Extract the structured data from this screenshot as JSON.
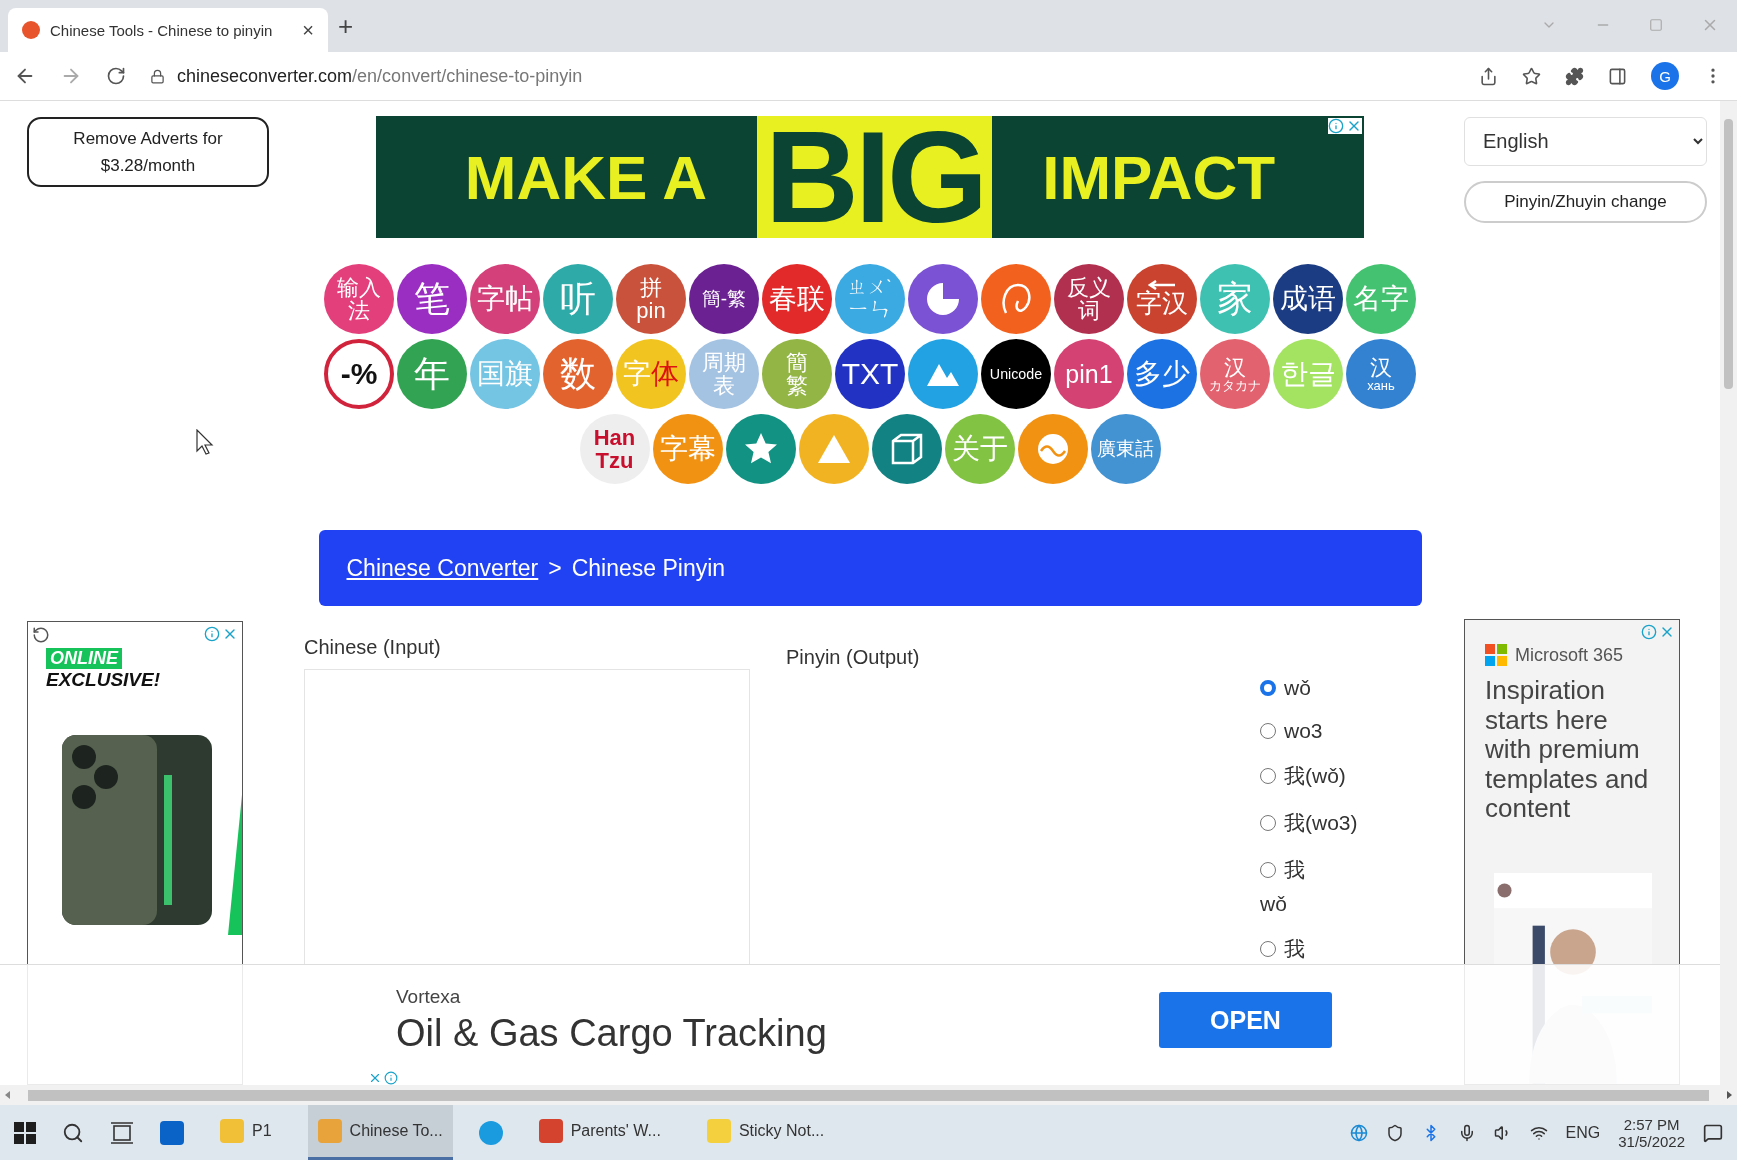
{
  "browser": {
    "tab_title": "Chinese Tools - Chinese to pinyin",
    "tab_close": "×",
    "new_tab": "+",
    "profile": "G",
    "url_domain": "chineseconverter.com",
    "url_path": "/en/convert/chinese-to-pinyin"
  },
  "remove_adverts": {
    "lines": [
      "Remove Adverts for",
      "$3.28/month"
    ]
  },
  "banner_ad": {
    "left": "MAKE A",
    "big": "BIG",
    "right": "IMPACT"
  },
  "language_select": {
    "value": "English"
  },
  "pinyin_zhuyin_button": "Pinyin/Zhuyin change",
  "tools": [
    [
      {
        "kind": "text",
        "color": "#e33f7a",
        "lines": [
          "输入",
          "法"
        ]
      },
      {
        "kind": "text",
        "color": "#9a2ec2",
        "lines": [
          "笔"
        ]
      },
      {
        "kind": "text",
        "color": "#d4407a",
        "lines": [
          "字帖"
        ]
      },
      {
        "kind": "text",
        "color": "#2eaaa8",
        "lines": [
          "听"
        ]
      },
      {
        "kind": "text",
        "color": "#c9523c",
        "lines": [
          "拼",
          "pin"
        ]
      },
      {
        "kind": "text",
        "color": "#6b2192",
        "lines": [
          "簡-繁"
        ]
      },
      {
        "kind": "text",
        "color": "#e22a2a",
        "lines": [
          "春联"
        ]
      },
      {
        "kind": "text",
        "color": "#3ba9e2",
        "lines": [
          "ㄓㄨˋ",
          "ㄧㄣ"
        ]
      },
      {
        "kind": "pie",
        "color": "#7b52d3"
      },
      {
        "kind": "spiral",
        "color": "#f2621e"
      },
      {
        "kind": "text",
        "color": "#b2304f",
        "lines": [
          "反义",
          "词"
        ]
      },
      {
        "kind": "arrow",
        "color": "#c9432f",
        "lines": [
          "字汉"
        ]
      },
      {
        "kind": "text",
        "color": "#3fc1b1",
        "lines": [
          "家"
        ]
      },
      {
        "kind": "text",
        "color": "#1b3b82",
        "lines": [
          "成语"
        ]
      },
      {
        "kind": "text",
        "color": "#45c271",
        "lines": [
          "名字"
        ]
      }
    ],
    [
      {
        "kind": "ring",
        "color": "#ffffff",
        "lines": [
          "-%"
        ]
      },
      {
        "kind": "text",
        "color": "#31a352",
        "lines": [
          "年"
        ]
      },
      {
        "kind": "text",
        "color": "#74c4e4",
        "lines": [
          "国旗"
        ]
      },
      {
        "kind": "text",
        "color": "#e3632f",
        "lines": [
          "数"
        ]
      },
      {
        "kind": "duotone",
        "color": "#f2c41f",
        "lines": [
          "字",
          "体"
        ]
      },
      {
        "kind": "text",
        "color": "#a4c2e2",
        "lines": [
          "周期",
          "表"
        ]
      },
      {
        "kind": "text",
        "color": "#92b545",
        "lines": [
          "簡",
          "繁"
        ]
      },
      {
        "kind": "text",
        "color": "#2232c2",
        "lines": [
          "TXT"
        ]
      },
      {
        "kind": "mountain",
        "color": "#22a2e2"
      },
      {
        "kind": "text",
        "color": "#000000",
        "lines": [
          "Unicode"
        ]
      },
      {
        "kind": "text",
        "color": "#d34272",
        "lines": [
          "pin1"
        ]
      },
      {
        "kind": "text",
        "color": "#1c72e2",
        "lines": [
          "多少"
        ]
      },
      {
        "kind": "text",
        "color": "#e3626f",
        "lines": [
          "汉",
          "カタカナ"
        ]
      },
      {
        "kind": "text",
        "color": "#a4e262",
        "lines": [
          "한글"
        ]
      },
      {
        "kind": "text",
        "color": "#3382d2",
        "lines": [
          "汉",
          "хань"
        ]
      }
    ],
    [
      {
        "kind": "pale",
        "color": "#eeeeee",
        "lines": [
          "Han",
          "Tzu"
        ]
      },
      {
        "kind": "text",
        "color": "#f29212",
        "lines": [
          "字幕"
        ]
      },
      {
        "kind": "star",
        "color": "#129282"
      },
      {
        "kind": "triangle",
        "color": "#f2b322"
      },
      {
        "kind": "cube",
        "color": "#128282"
      },
      {
        "kind": "text",
        "color": "#83c343",
        "lines": [
          "关于"
        ]
      },
      {
        "kind": "wave",
        "color": "#f29212"
      },
      {
        "kind": "text",
        "color": "#4392d2",
        "lines": [
          "廣東話"
        ]
      }
    ]
  ],
  "breadcrumb": {
    "link": "Chinese Converter",
    "separator": ">",
    "current": "Chinese Pinyin"
  },
  "input": {
    "label": "Chinese (Input)"
  },
  "output": {
    "label": "Pinyin (Output)"
  },
  "options": [
    {
      "lines": [
        "wǒ"
      ],
      "selected": true
    },
    {
      "lines": [
        "wo3"
      ],
      "selected": false
    },
    {
      "lines": [
        "我(wǒ)"
      ],
      "selected": false
    },
    {
      "lines": [
        "我(wo3)"
      ],
      "selected": false
    },
    {
      "lines": [
        "我",
        "wǒ"
      ],
      "selected": false
    },
    {
      "lines": [
        "我"
      ],
      "selected": false
    }
  ],
  "left_ad": {
    "tag": "ONLINE",
    "headline": "EXCLUSIVE!"
  },
  "right_ad": {
    "brand": "Microsoft 365",
    "headline": "Inspiration starts here with premium templates and content"
  },
  "bottom_ad": {
    "advertiser": "Vortexa",
    "headline": "Oil & Gas Cargo Tracking",
    "button": "OPEN"
  },
  "taskbar": {
    "items": [
      {
        "kind": "app",
        "label": "P1",
        "selected": false
      },
      {
        "kind": "app",
        "label": "Chinese To...",
        "selected": true
      },
      {
        "kind": "app",
        "label": "Parents' W...",
        "selected": false
      },
      {
        "kind": "app",
        "label": "Sticky Not...",
        "selected": false
      }
    ],
    "language": "ENG",
    "time": "2:57 PM",
    "date": "31/5/2022"
  }
}
